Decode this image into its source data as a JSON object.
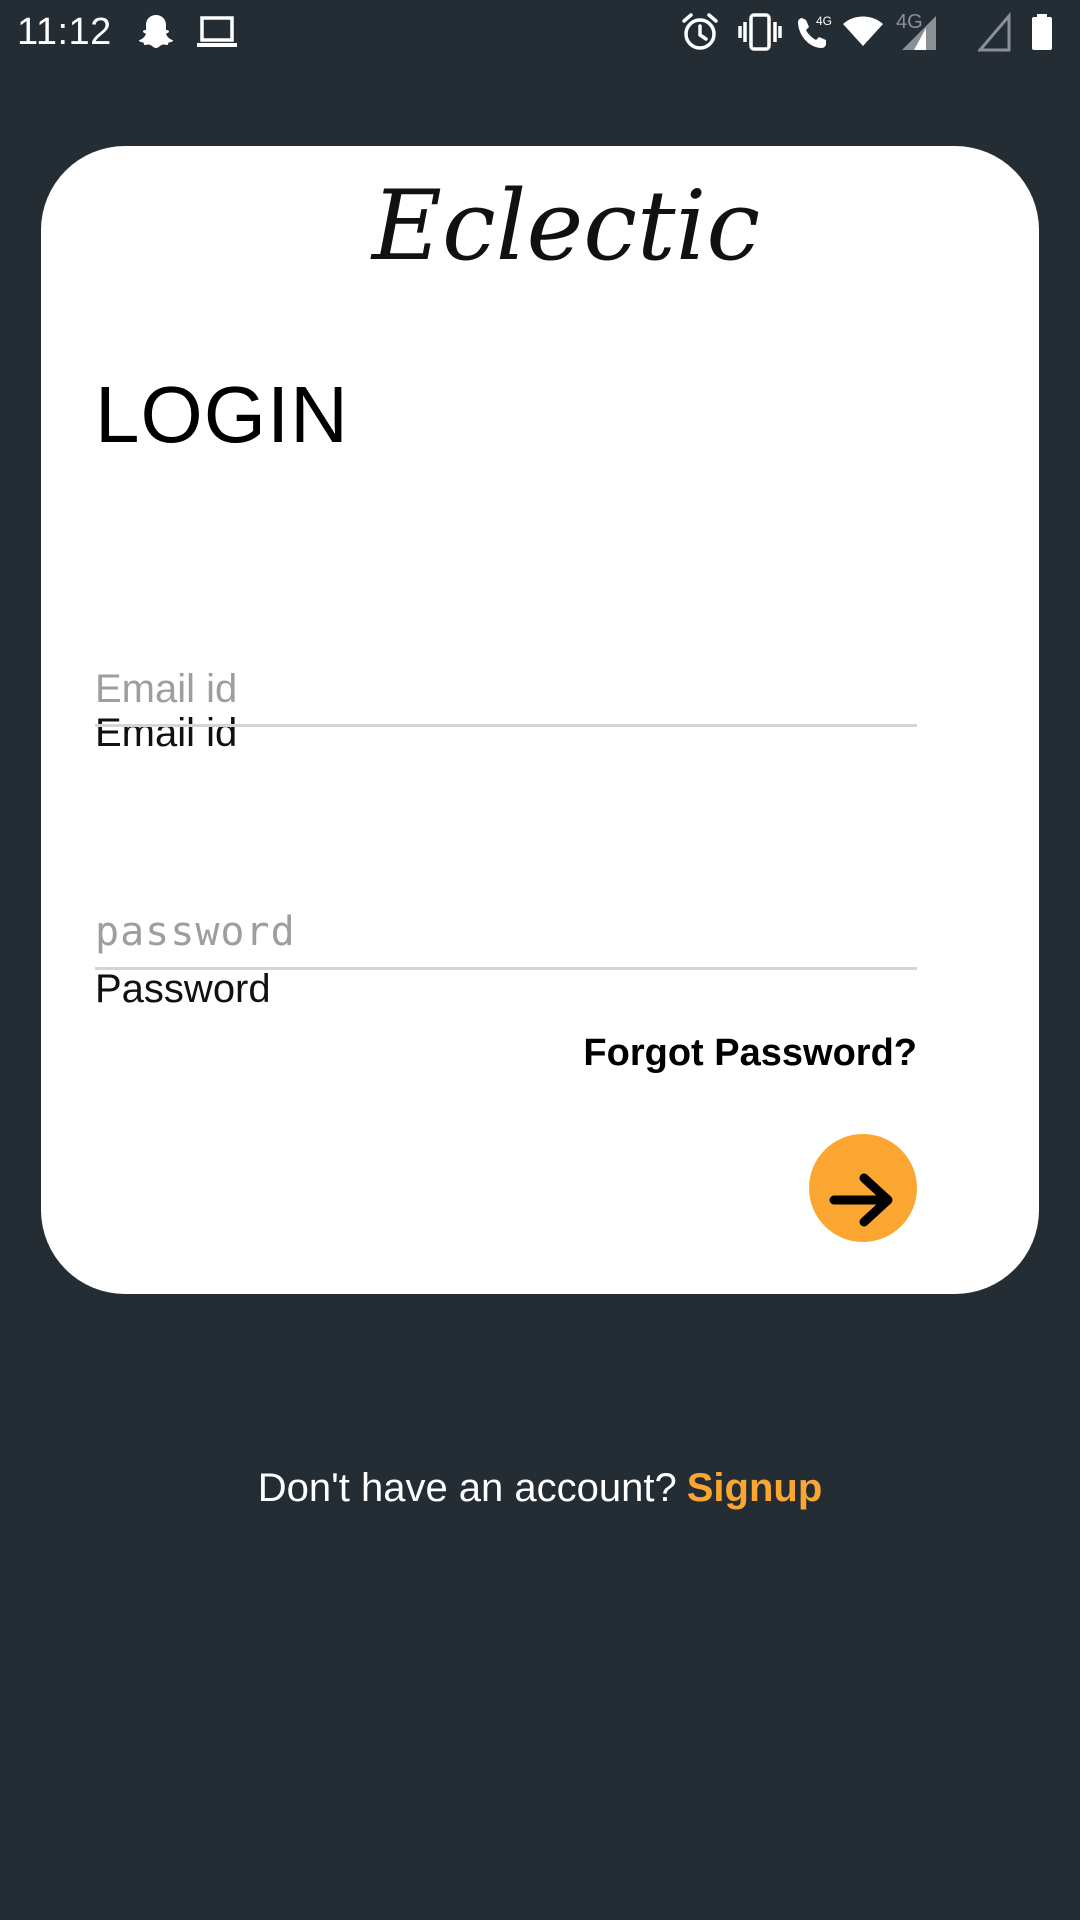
{
  "status_bar": {
    "time": "11:12",
    "network_label": "4G",
    "icons": [
      "snapchat-icon",
      "laptop-icon",
      "alarm-icon",
      "vibrate-icon",
      "wifi-call-icon",
      "wifi-icon",
      "signal-icon",
      "signal-empty-icon",
      "battery-icon"
    ]
  },
  "card": {
    "brand": "Eclectic",
    "title": "LOGIN",
    "email": {
      "label": "Email id",
      "placeholder": "Email id",
      "value": ""
    },
    "password": {
      "label": "Password",
      "placeholder": "password",
      "value": ""
    },
    "forgot_label": "Forgot Password?",
    "submit_icon": "arrow-right-icon"
  },
  "signup": {
    "prompt": "Don't have an account?",
    "link": "Signup"
  },
  "colors": {
    "background": "#242d34",
    "card": "#ffffff",
    "accent": "#fba630",
    "underline": "#d5d5d5",
    "placeholder": "#9e9e9e"
  }
}
